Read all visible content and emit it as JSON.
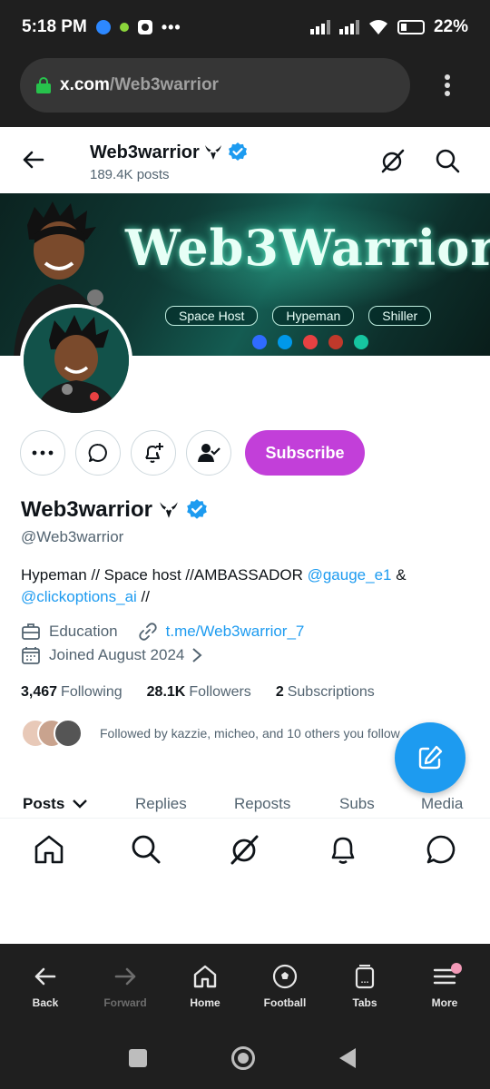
{
  "status_bar": {
    "time": "5:18 PM",
    "battery": "22%"
  },
  "browser": {
    "url_domain": "x.com",
    "url_path": "/Web3warrior"
  },
  "header": {
    "name": "Web3warrior",
    "posts_count": "189.4K posts"
  },
  "banner": {
    "title": "Web3Warrior",
    "tags": [
      "Space Host",
      "Hypeman",
      "Shiller"
    ]
  },
  "actions": {
    "subscribe_label": "Subscribe"
  },
  "profile": {
    "name": "Web3warrior",
    "handle": "@Web3warrior",
    "bio_text1": "Hypeman // Space host //AMBASSADOR ",
    "bio_mention1": "@gauge_e1",
    "bio_text2": " & ",
    "bio_mention2": "@clickoptions_ai",
    "bio_text3": " //",
    "category": "Education",
    "website": "t.me/Web3warrior_7",
    "joined": "Joined August 2024"
  },
  "stats": {
    "following_count": "3,467",
    "following_label": "Following",
    "followers_count": "28.1K",
    "followers_label": "Followers",
    "subscriptions_count": "2",
    "subscriptions_label": "Subscriptions"
  },
  "followed_by": "Followed by kazzie, micheo, and 10 others you follow",
  "tabs": [
    "Posts",
    "Replies",
    "Reposts",
    "Subs",
    "Media"
  ],
  "browser_toolbar": {
    "back": "Back",
    "forward": "Forward",
    "home": "Home",
    "football": "Football",
    "tabs": "Tabs",
    "more": "More"
  },
  "colors": {
    "accent_blue": "#1d9bf0",
    "subscribe_purple": "#c23fd9",
    "verified_blue": "#1d9bf0"
  }
}
